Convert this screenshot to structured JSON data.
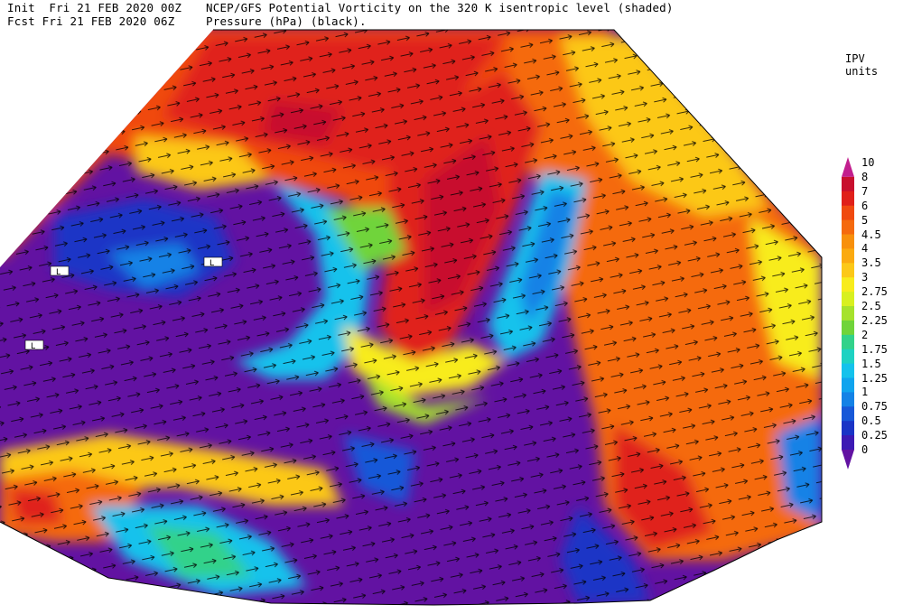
{
  "header": {
    "init_line": "Init  Fri 21 FEB 2020 00Z",
    "fcst_line": "Fcst Fri 21 FEB 2020 06Z",
    "title_line1": "NCEP/GFS Potential Vorticity on the 320 K isentropic level (shaded)",
    "title_line2": "Pressure (hPa) (black)."
  },
  "legend": {
    "title": "IPV units",
    "levels": [
      {
        "label": "10",
        "color": "#c21f8e"
      },
      {
        "label": "8",
        "color": "#c8102e"
      },
      {
        "label": "7",
        "color": "#e0201a"
      },
      {
        "label": "6",
        "color": "#f04a10"
      },
      {
        "label": "5",
        "color": "#f56a0e"
      },
      {
        "label": "4.5",
        "color": "#f8900c"
      },
      {
        "label": "4",
        "color": "#fbaa10"
      },
      {
        "label": "3.5",
        "color": "#fcc818"
      },
      {
        "label": "3",
        "color": "#f8ec1c"
      },
      {
        "label": "2.75",
        "color": "#d8f020"
      },
      {
        "label": "2.5",
        "color": "#a6e22c"
      },
      {
        "label": "2.25",
        "color": "#70d43a"
      },
      {
        "label": "2",
        "color": "#32d28a"
      },
      {
        "label": "1.75",
        "color": "#1ed2c2"
      },
      {
        "label": "1.5",
        "color": "#14c2ec"
      },
      {
        "label": "1.25",
        "color": "#10a4ee"
      },
      {
        "label": "1",
        "color": "#1482e6"
      },
      {
        "label": "0.75",
        "color": "#1758d8"
      },
      {
        "label": "0.5",
        "color": "#1a34c6"
      },
      {
        "label": "0.25",
        "color": "#3c1ab4"
      },
      {
        "label": "0",
        "color": "#6212a2"
      }
    ]
  },
  "map": {
    "pressure_labels": [
      "L",
      "L",
      "L"
    ]
  }
}
